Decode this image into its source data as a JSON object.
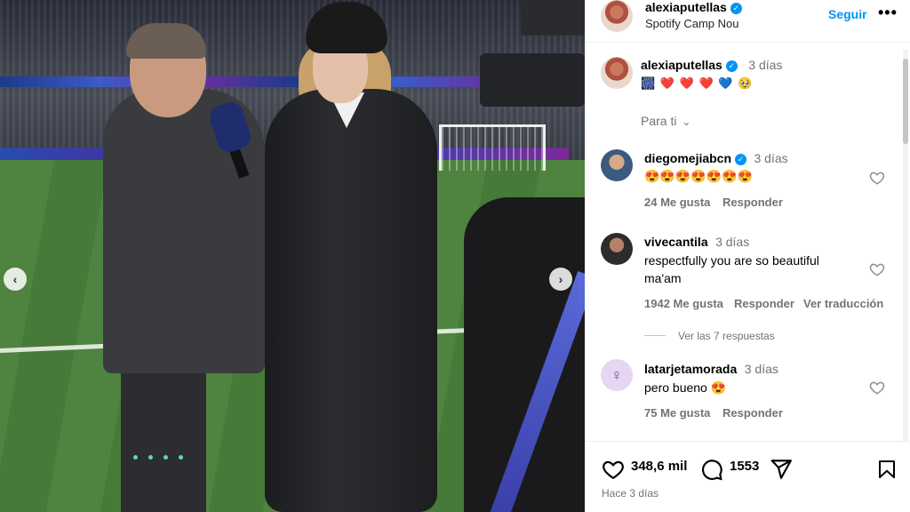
{
  "post": {
    "username": "alexiaputellas",
    "location": "Spotify Camp Nou",
    "follow_label": "Seguir",
    "more_label": "•••"
  },
  "caption": {
    "username": "alexiaputellas",
    "time": "3 días",
    "emojis": [
      "🎆",
      "❤️",
      "❤️",
      "❤️",
      "💙",
      "🥹"
    ]
  },
  "sort": {
    "label": "Para ti",
    "chevron": "⌵"
  },
  "comments": [
    {
      "username": "diegomejiabcn",
      "verified": true,
      "time": "3 días",
      "text": "😍😍😍😍😍😍😍",
      "likes": "24 Me gusta",
      "reply": "Responder"
    },
    {
      "username": "vivecantila",
      "verified": false,
      "time": "3 días",
      "text_line1": "respectfully you are so beautiful",
      "text_line2": "ma'am",
      "likes": "1942 Me gusta",
      "reply": "Responder",
      "translate": "Ver traducción",
      "view_replies": "Ver las 7 respuestas"
    },
    {
      "username": "latarjetamorada",
      "verified": false,
      "time": "3 días",
      "text": "pero bueno 😍",
      "likes": "75 Me gusta",
      "reply": "Responder"
    }
  ],
  "actions": {
    "likes": "348,6 mil",
    "comments": "1553",
    "posted": "Hace 3 días"
  },
  "icons": {
    "heart": "heart-icon",
    "comment": "comment-icon",
    "share": "share-icon",
    "save": "bookmark-icon",
    "prev": "chevron-left-icon",
    "next": "chevron-right-icon"
  },
  "colors": {
    "accent": "#0095f6",
    "muted": "#737373"
  }
}
